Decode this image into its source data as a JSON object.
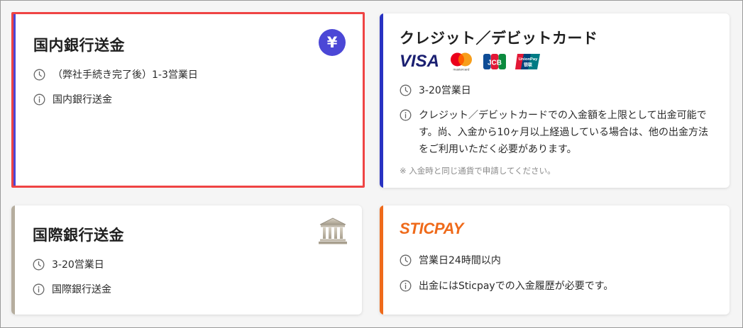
{
  "colors": {
    "selected_border": "#ef4444",
    "domestic_accent": "#4b47d6",
    "card_accent": "#2832c2",
    "intl_accent": "#b5ad9e",
    "sticpay_accent": "#ef6a1a"
  },
  "cards": {
    "domestic": {
      "title": "国内銀行送金",
      "badge": "¥",
      "time": "（弊社手続き完了後）1-3営業日",
      "info": "国内銀行送金"
    },
    "card": {
      "title": "クレジット／デビットカード",
      "brands": {
        "visa": "VISA",
        "mastercard": "mastercard",
        "jcb": "JCB",
        "unionpay_line1": "UnionPay",
        "unionpay_line2": "银联"
      },
      "time": "3-20営業日",
      "info": "クレジット／デビットカードでの入金額を上限として出金可能です。尚、入金から10ヶ月以上経過している場合は、他の出金方法をご利用いただく必要があります。",
      "note": "※ 入金時と同じ通貨で申請してください。"
    },
    "international": {
      "title": "国際銀行送金",
      "time": "3-20営業日",
      "info": "国際銀行送金"
    },
    "sticpay": {
      "logo": "STICPAY",
      "time": "営業日24時間以内",
      "info": "出金にはSticpayでの入金履歴が必要です。"
    }
  }
}
